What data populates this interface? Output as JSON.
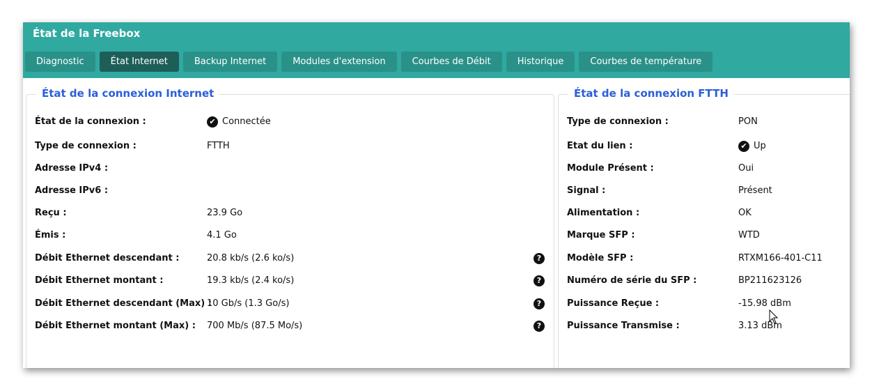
{
  "window": {
    "title": "État de la Freebox"
  },
  "tabs": [
    {
      "label": "Diagnostic"
    },
    {
      "label": "État Internet",
      "active": true
    },
    {
      "label": "Backup Internet"
    },
    {
      "label": "Modules d'extension"
    },
    {
      "label": "Courbes de Débit"
    },
    {
      "label": "Historique"
    },
    {
      "label": "Courbes de température"
    }
  ],
  "internet": {
    "title": "État de la connexion Internet",
    "rows": [
      {
        "label": "État de la connexion :",
        "value": "Connectée",
        "icon": "check-circle"
      },
      {
        "label": "Type de connexion :",
        "value": "FTTH"
      },
      {
        "label": "Adresse IPv4 :",
        "value": ""
      },
      {
        "label": "Adresse IPv6 :",
        "value": ""
      },
      {
        "label": "Reçu :",
        "value": "23.9 Go"
      },
      {
        "label": "Émis :",
        "value": "4.1 Go"
      },
      {
        "label": "Débit Ethernet descendant :",
        "value": "20.8 kb/s (2.6 ko/s)",
        "help": "?"
      },
      {
        "label": "Débit Ethernet montant :",
        "value": "19.3 kb/s (2.4 ko/s)",
        "help": "?"
      },
      {
        "label": "Débit Ethernet descendant (Max) :",
        "value": "10 Gb/s (1.3 Go/s)",
        "help": "?"
      },
      {
        "label": "Débit Ethernet montant (Max) :",
        "value": "700 Mb/s (87.5 Mo/s)",
        "help": "?"
      }
    ]
  },
  "ftth": {
    "title": "État de la connexion FTTH",
    "rows": [
      {
        "label": "Type de connexion :",
        "value": "PON"
      },
      {
        "label": "Etat du lien :",
        "value": "Up",
        "icon": "check-circle"
      },
      {
        "label": "Module Présent :",
        "value": "Oui"
      },
      {
        "label": "Signal :",
        "value": "Présent"
      },
      {
        "label": "Alimentation :",
        "value": "OK"
      },
      {
        "label": "Marque SFP :",
        "value": "WTD"
      },
      {
        "label": "Modèle SFP :",
        "value": "RTXM166-401-C11"
      },
      {
        "label": "Numéro de série du SFP :",
        "value": "BP211623126"
      },
      {
        "label": "Puissance Reçue :",
        "value": "-15.98 dBm"
      },
      {
        "label": "Puissance Transmise :",
        "value": "3.13 dBm"
      }
    ]
  },
  "icons": {
    "check": "✔"
  }
}
